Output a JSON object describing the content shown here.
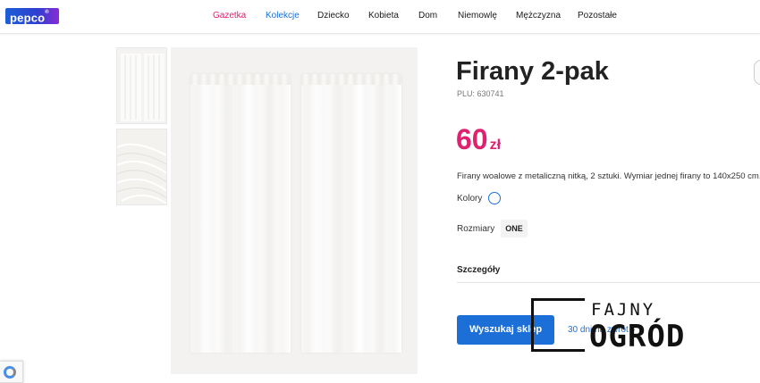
{
  "brand": {
    "logo": "pepco",
    "accent": "#e0216f",
    "primary": "#1d6fd8"
  },
  "nav": {
    "items": [
      {
        "label": "Gazetka",
        "color": "#e0216f"
      },
      {
        "label": "Kolekcje",
        "color": "#1d6fd8"
      },
      {
        "label": "Dziecko"
      },
      {
        "label": "Kobieta"
      },
      {
        "label": "Dom"
      },
      {
        "label": "Niemowlę"
      },
      {
        "label": "Mężczyzna"
      },
      {
        "label": "Pozostałe"
      }
    ]
  },
  "product": {
    "title": "Firany 2-pak",
    "plu": "PLU: 630741",
    "price_value": "60",
    "price_currency": "zł",
    "description": "Firany woalowe z metaliczną nitką, 2 sztuki. Wymiar jednej firany to 140x250 cm.",
    "colors_label": "Kolory",
    "sizes_label": "Rozmiary",
    "size_option": "ONE",
    "details_label": "Szczegóły",
    "search_button": "Wyszukaj sklep",
    "return_text": "30 dni na zwrot",
    "return_arrow": "›"
  },
  "watermark": {
    "line1": "FAJNY",
    "line2": "OGRÓD"
  },
  "icons": {
    "recaptcha": "recaptcha-icon",
    "color_swatch": "white-swatch-icon"
  }
}
